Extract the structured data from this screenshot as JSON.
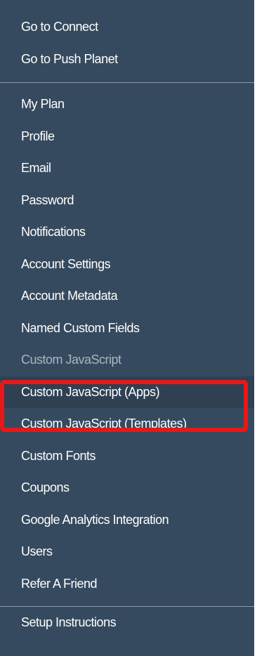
{
  "menu": {
    "top_items": [
      {
        "label": "Go to Connect"
      },
      {
        "label": "Go to Push Planet"
      }
    ],
    "main_items": [
      {
        "label": "My Plan"
      },
      {
        "label": "Profile"
      },
      {
        "label": "Email"
      },
      {
        "label": "Password"
      },
      {
        "label": "Notifications"
      },
      {
        "label": "Account Settings"
      },
      {
        "label": "Account Metadata"
      },
      {
        "label": "Named Custom Fields"
      },
      {
        "label": "Custom JavaScript"
      },
      {
        "label": "Custom JavaScript (Apps)"
      },
      {
        "label": "Custom JavaScript (Templates)"
      },
      {
        "label": "Custom Fonts"
      },
      {
        "label": "Coupons"
      },
      {
        "label": "Google Analytics Integration"
      },
      {
        "label": "Users"
      },
      {
        "label": "Refer A Friend"
      }
    ],
    "bottom_items": [
      {
        "label": "Setup Instructions"
      }
    ]
  },
  "colors": {
    "menu_background": "#354a5e",
    "text": "#ffffff",
    "muted_text": "#a9b5c1",
    "highlight_border": "#e81818"
  }
}
